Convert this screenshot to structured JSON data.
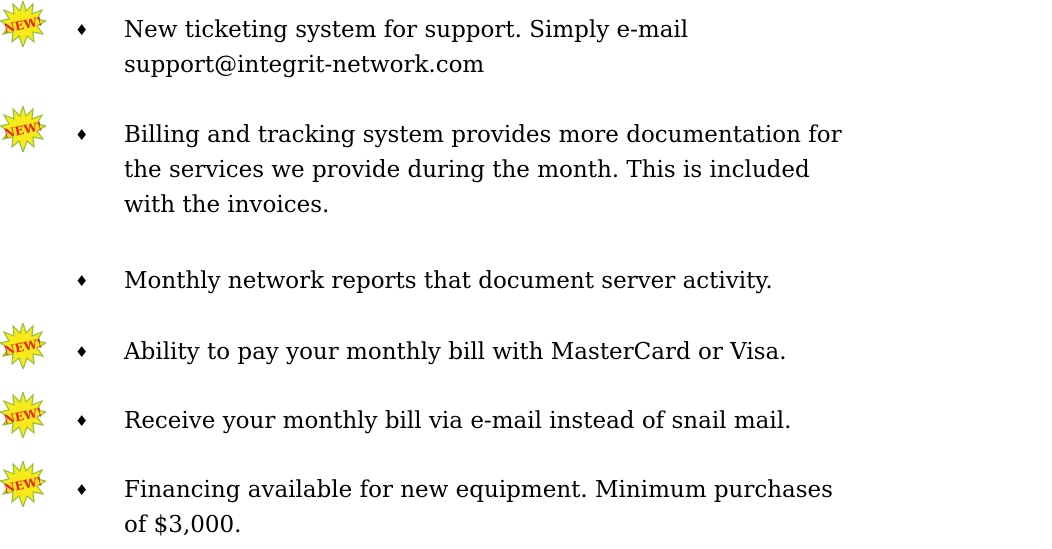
{
  "colors": {
    "text": "#000000",
    "badge_burst": "#f7e91a",
    "badge_burst_stroke": "#8fbf3a",
    "badge_text": "#e8251e"
  },
  "badge": {
    "label": "NEW!",
    "icon": "new-starburst-icon"
  },
  "bullet_glyph": "♦",
  "items": [
    {
      "new": true,
      "lines": [
        "New ticketing system for support.  Simply e-mail",
        "support@integrit-network.com"
      ]
    },
    {
      "new": true,
      "lines": [
        "Billing and tracking system provides more documentation for",
        "the services we provide during the month. This is included",
        "with the invoices."
      ]
    },
    {
      "new": false,
      "lines": [
        "Monthly network reports that document server activity."
      ]
    },
    {
      "new": true,
      "lines": [
        "Ability to pay your monthly bill with MasterCard or Visa."
      ]
    },
    {
      "new": true,
      "lines": [
        "Receive your monthly bill via e-mail instead of snail mail."
      ]
    },
    {
      "new": true,
      "lines": [
        "Financing available for new equipment.  Minimum purchases",
        "of $3,000."
      ]
    }
  ]
}
